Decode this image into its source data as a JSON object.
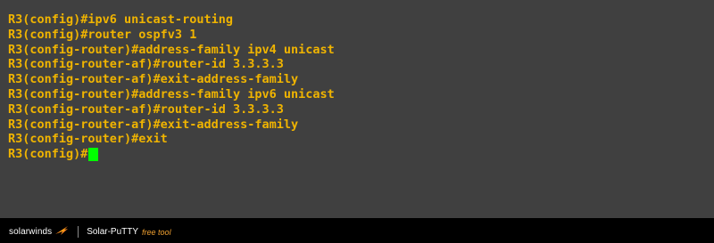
{
  "terminal": {
    "lines": [
      "R3(config)#ipv6 unicast-routing",
      "R3(config)#router ospfv3 1",
      "R3(config-router)#address-family ipv4 unicast",
      "R3(config-router-af)#router-id 3.3.3.3",
      "R3(config-router-af)#exit-address-family",
      "R3(config-router)#address-family ipv6 unicast",
      "R3(config-router-af)#router-id 3.3.3.3",
      "R3(config-router-af)#exit-address-family",
      "R3(config-router)#exit"
    ],
    "prompt": "R3(config)#",
    "text_color": "#f0b400",
    "background_color": "#404040",
    "cursor_color": "#00ff00"
  },
  "footer": {
    "brand": "solarwinds",
    "product": "Solar-PuTTY",
    "tag": "free tool",
    "brand_icon": "solarwinds-flame-icon"
  }
}
